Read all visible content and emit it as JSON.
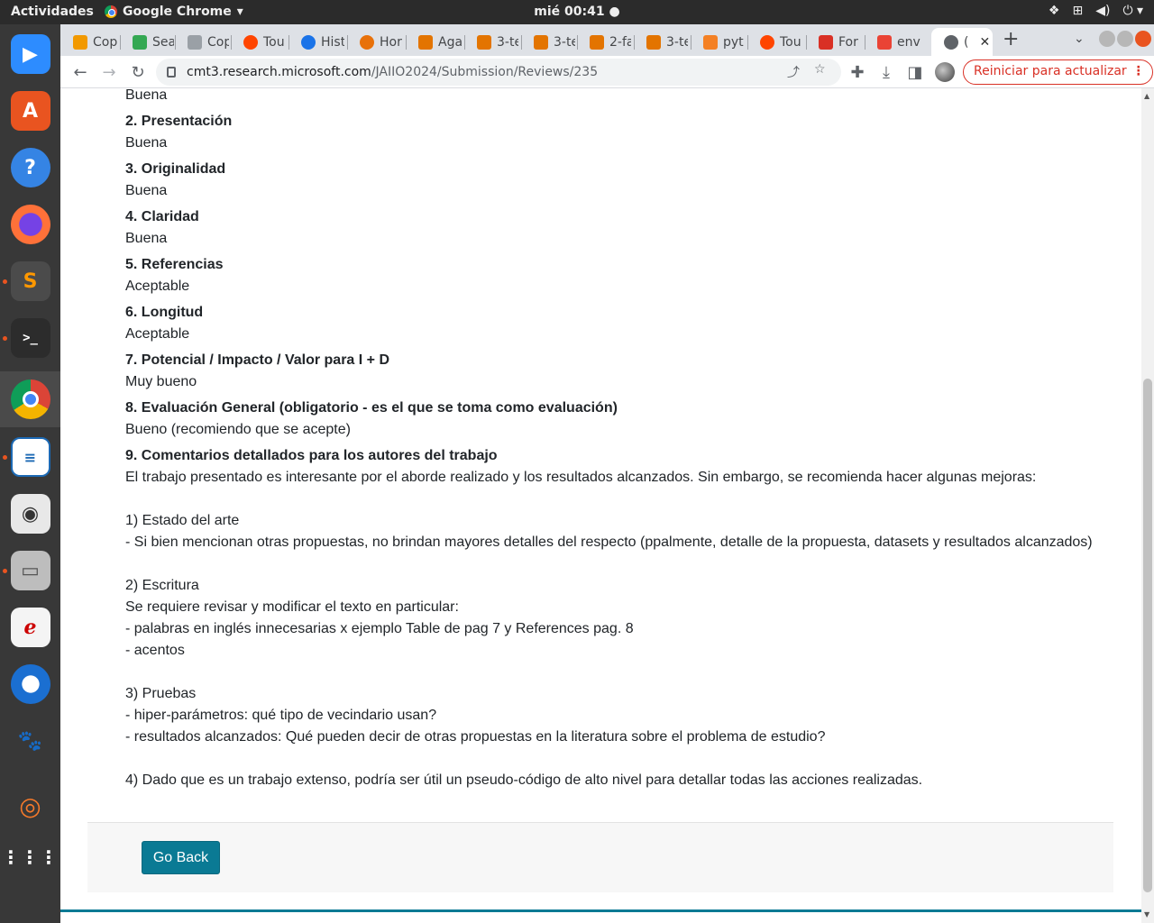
{
  "system": {
    "activities": "Actividades",
    "app_name": "Google Chrome",
    "clock": "mié 00:41"
  },
  "browser": {
    "tabs": [
      {
        "label": "Cop",
        "color": "#f29900"
      },
      {
        "label": "Sea",
        "color": "#34a853"
      },
      {
        "label": "Cop",
        "color": "#9aa0a6"
      },
      {
        "label": "Tou",
        "color": "#ff4500"
      },
      {
        "label": "Hist",
        "color": "#1a73e8"
      },
      {
        "label": "Hor",
        "color": "#e8710a"
      },
      {
        "label": "Aga",
        "color": "#e37400"
      },
      {
        "label": "3-te",
        "color": "#e37400"
      },
      {
        "label": "3-te",
        "color": "#e37400"
      },
      {
        "label": "2-fa",
        "color": "#e37400"
      },
      {
        "label": "3-te",
        "color": "#e37400"
      },
      {
        "label": "pyt",
        "color": "#f48024"
      },
      {
        "label": "Tou",
        "color": "#ff4500"
      },
      {
        "label": "For",
        "color": "#d93025"
      },
      {
        "label": "env",
        "color": "#ea4335"
      },
      {
        "label": "(",
        "color": "#5f6368"
      }
    ],
    "url_host": "cmt3.research.microsoft.com",
    "url_path": "/JAIIO2024/Submission/Reviews/235",
    "restart_label": "Reiniciar para actualizar"
  },
  "review": {
    "first_answer": "Buena",
    "questions": [
      {
        "title": "2. Presentación",
        "answer": "Buena"
      },
      {
        "title": "3. Originalidad",
        "answer": "Buena"
      },
      {
        "title": "4. Claridad",
        "answer": "Buena"
      },
      {
        "title": "5. Referencias",
        "answer": "Aceptable"
      },
      {
        "title": "6. Longitud",
        "answer": "Aceptable"
      },
      {
        "title": "7. Potencial / Impacto / Valor para I + D",
        "answer": "Muy bueno"
      },
      {
        "title": "8. Evaluación General (obligatorio - es el que se toma como evaluación)",
        "answer": "Bueno (recomiendo que se acepte)"
      }
    ],
    "comments_title": "9. Comentarios detallados para los autores del trabajo",
    "comments": [
      "El trabajo presentado es interesante por el aborde realizado y los resultados alcanzados. Sin embargo, se recomienda hacer algunas mejoras:",
      "",
      "1) Estado del arte",
      "- Si bien mencionan otras propuestas, no brindan mayores detalles del respecto (ppalmente, detalle de la propuesta, datasets y resultados alcanzados)",
      "",
      "2) Escritura",
      "Se requiere revisar y modificar el texto en particular:",
      "- palabras en inglés innecesarias x ejemplo Table de pag 7 y References pag. 8",
      "- acentos",
      "",
      "3) Pruebas",
      "- hiper-parámetros: qué tipo de vecindario usan?",
      "- resultados alcanzados: Qué pueden decir de otras propuestas en la literatura sobre el problema de estudio?",
      "",
      "4) Dado que es un trabajo extenso, podría ser útil un pseudo-código de alto nivel para detallar todas las acciones realizadas."
    ],
    "go_back_label": "Go Back"
  }
}
